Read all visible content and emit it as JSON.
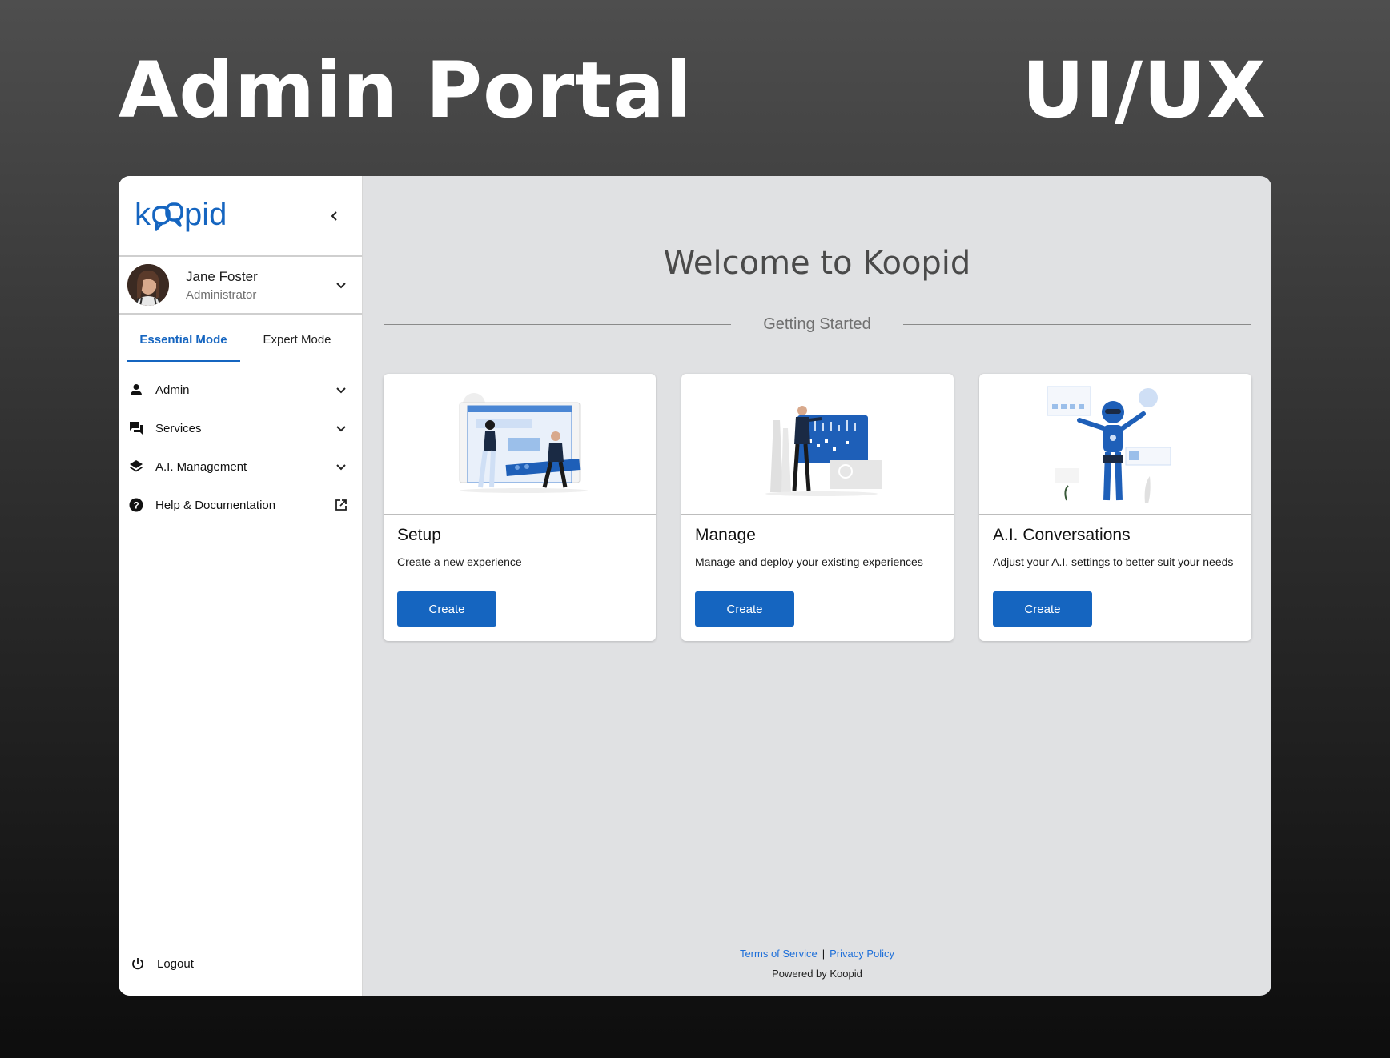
{
  "hero": {
    "title": "Admin Portal",
    "tag": "UI/UX"
  },
  "brand": {
    "name": "koopid",
    "color": "#1565c0"
  },
  "user": {
    "name": "Jane Foster",
    "role": "Administrator"
  },
  "modes": {
    "essential": "Essential Mode",
    "expert": "Expert Mode",
    "active": "essential"
  },
  "nav": [
    {
      "label": "Admin",
      "icon": "person-icon",
      "trailing": "chevron-down-icon"
    },
    {
      "label": "Services",
      "icon": "forum-icon",
      "trailing": "chevron-down-icon"
    },
    {
      "label": "A.I. Management",
      "icon": "layers-icon",
      "trailing": "chevron-down-icon"
    },
    {
      "label": "Help & Documentation",
      "icon": "help-circle-icon",
      "trailing": "external-link-icon"
    }
  ],
  "logout": {
    "label": "Logout",
    "icon": "power-icon"
  },
  "main": {
    "welcome": "Welcome to Koopid",
    "section": "Getting Started",
    "cards": [
      {
        "title": "Setup",
        "description": "Create a new experience",
        "button": "Create"
      },
      {
        "title": "Manage",
        "description": "Manage and deploy your existing experiences",
        "button": "Create"
      },
      {
        "title": "A.I. Conversations",
        "description": "Adjust your A.I. settings to better suit your needs",
        "button": "Create"
      }
    ]
  },
  "footer": {
    "terms": "Terms of Service",
    "privacy": "Privacy Policy",
    "powered": "Powered by Koopid"
  },
  "colors": {
    "accent": "#1565c0",
    "link": "#1e6fd9",
    "main_bg": "#e0e1e3"
  }
}
